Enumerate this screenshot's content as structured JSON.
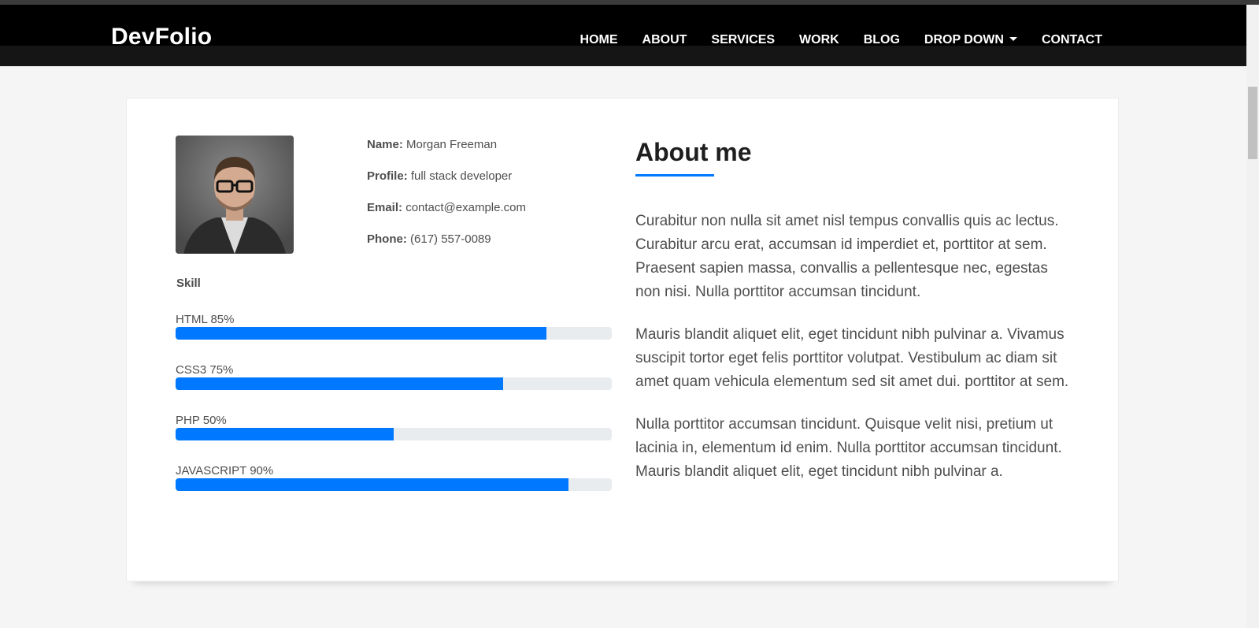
{
  "brand": "DevFolio",
  "nav": {
    "items": [
      "HOME",
      "ABOUT",
      "SERVICES",
      "WORK",
      "BLOG",
      "DROP DOWN",
      "CONTACT"
    ]
  },
  "profile": {
    "name_label": "Name:",
    "name": "Morgan Freeman",
    "profile_label": "Profile:",
    "profile": "full stack developer",
    "email_label": "Email:",
    "email": "contact@example.com",
    "phone_label": "Phone:",
    "phone": "(617) 557-0089"
  },
  "skills": {
    "title": "Skill",
    "items": [
      {
        "label": "HTML 85%",
        "percent": 85
      },
      {
        "label": "CSS3 75%",
        "percent": 75
      },
      {
        "label": "PHP 50%",
        "percent": 50
      },
      {
        "label": "JAVASCRIPT 90%",
        "percent": 90
      }
    ]
  },
  "about": {
    "title": "About me",
    "paragraphs": [
      "Curabitur non nulla sit amet nisl tempus convallis quis ac lectus. Curabitur arcu erat, accumsan id imperdiet et, porttitor at sem. Praesent sapien massa, convallis a pellentesque nec, egestas non nisi. Nulla porttitor accumsan tincidunt.",
      "Mauris blandit aliquet elit, eget tincidunt nibh pulvinar a. Vivamus suscipit tortor eget felis porttitor volutpat. Vestibulum ac diam sit amet quam vehicula elementum sed sit amet dui. porttitor at sem.",
      "Nulla porttitor accumsan tincidunt. Quisque velit nisi, pretium ut lacinia in, elementum id enim. Nulla porttitor accumsan tincidunt. Mauris blandit aliquet elit, eget tincidunt nibh pulvinar a."
    ]
  },
  "colors": {
    "accent": "#0078ff",
    "navbar": "#000000",
    "text": "#4e4e4e"
  }
}
